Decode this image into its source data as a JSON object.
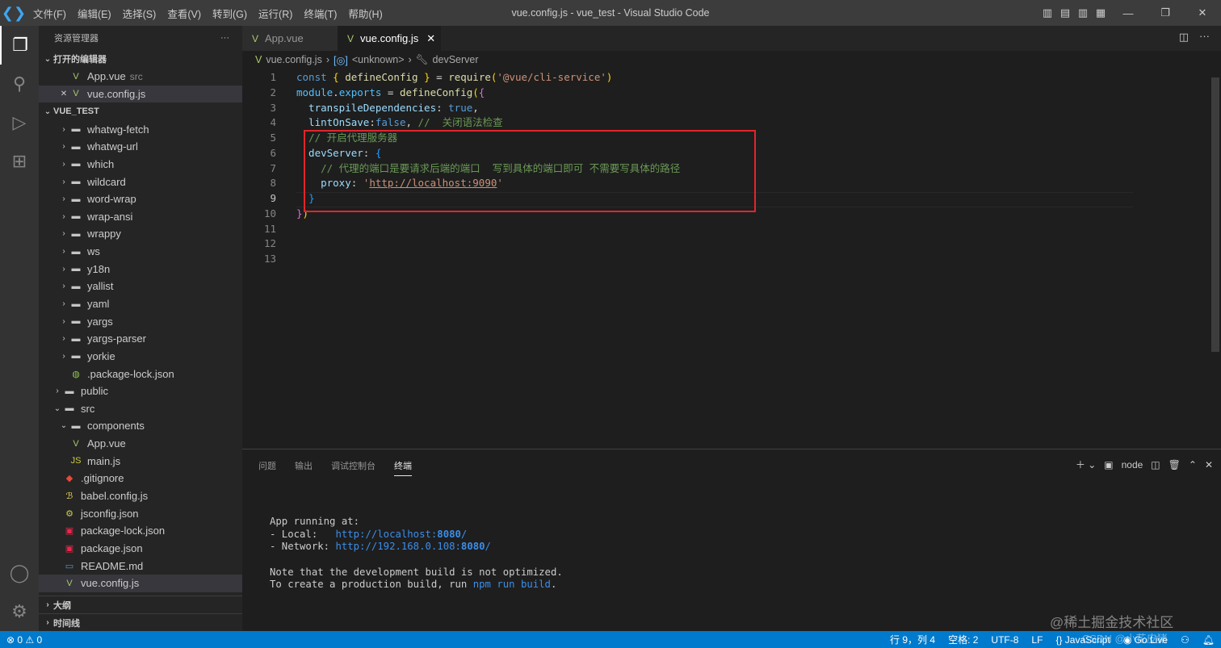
{
  "window": {
    "title": "vue.config.js - vue_test - Visual Studio Code"
  },
  "menu": [
    "文件(F)",
    "编辑(E)",
    "选择(S)",
    "查看(V)",
    "转到(G)",
    "运行(R)",
    "终端(T)",
    "帮助(H)"
  ],
  "sidebar": {
    "title": "资源管理器",
    "more": "···",
    "open_editors_header": "打开的编辑器",
    "open_editors": [
      {
        "name": "App.vue",
        "hint": "src",
        "icon": "vue-icon"
      },
      {
        "name": "vue.config.js",
        "hint": "",
        "icon": "vue-icon",
        "selected": true
      }
    ],
    "project_header": "VUE_TEST",
    "tree": [
      {
        "name": "whatwg-fetch",
        "type": "folder",
        "depth": 2
      },
      {
        "name": "whatwg-url",
        "type": "folder",
        "depth": 2
      },
      {
        "name": "which",
        "type": "folder",
        "depth": 2
      },
      {
        "name": "wildcard",
        "type": "folder",
        "depth": 2
      },
      {
        "name": "word-wrap",
        "type": "folder",
        "depth": 2
      },
      {
        "name": "wrap-ansi",
        "type": "folder",
        "depth": 2
      },
      {
        "name": "wrappy",
        "type": "folder",
        "depth": 2
      },
      {
        "name": "ws",
        "type": "folder",
        "depth": 2
      },
      {
        "name": "y18n",
        "type": "folder",
        "depth": 2
      },
      {
        "name": "yallist",
        "type": "folder",
        "depth": 2
      },
      {
        "name": "yaml",
        "type": "folder",
        "depth": 2
      },
      {
        "name": "yargs",
        "type": "folder",
        "depth": 2
      },
      {
        "name": "yargs-parser",
        "type": "folder",
        "depth": 2
      },
      {
        "name": "yorkie",
        "type": "folder",
        "depth": 2
      },
      {
        "name": ".package-lock.json",
        "type": "json",
        "depth": 2
      },
      {
        "name": "public",
        "type": "folder",
        "depth": 1
      },
      {
        "name": "src",
        "type": "folder-open",
        "depth": 1
      },
      {
        "name": "components",
        "type": "folder-open",
        "depth": 2
      },
      {
        "name": "App.vue",
        "type": "vue",
        "depth": 2
      },
      {
        "name": "main.js",
        "type": "js",
        "depth": 2
      },
      {
        "name": ".gitignore",
        "type": "git",
        "depth": 1
      },
      {
        "name": "babel.config.js",
        "type": "babel",
        "depth": 1
      },
      {
        "name": "jsconfig.json",
        "type": "jsconfig",
        "depth": 1
      },
      {
        "name": "package-lock.json",
        "type": "npm",
        "depth": 1
      },
      {
        "name": "package.json",
        "type": "npm",
        "depth": 1
      },
      {
        "name": "README.md",
        "type": "md",
        "depth": 1
      },
      {
        "name": "vue.config.js",
        "type": "vue",
        "depth": 1,
        "selected": true
      }
    ],
    "outline_header": "大纲",
    "timeline_header": "时间线"
  },
  "tabs": [
    {
      "label": "App.vue",
      "active": false
    },
    {
      "label": "vue.config.js",
      "active": true
    }
  ],
  "breadcrumb": [
    "vue.config.js",
    "<unknown>",
    "devServer"
  ],
  "code": [
    [
      [
        "const ",
        "kw"
      ],
      [
        "{ ",
        "br1"
      ],
      [
        "defineConfig ",
        "fn"
      ],
      [
        "} ",
        "br1"
      ],
      [
        "= ",
        "pl"
      ],
      [
        "require",
        "fn"
      ],
      [
        "(",
        "br1"
      ],
      [
        "'@vue/cli-service'",
        "str"
      ],
      [
        ")",
        "br1"
      ]
    ],
    [
      [
        "module",
        "var2"
      ],
      [
        ".",
        "pl"
      ],
      [
        "exports",
        "var2"
      ],
      [
        " = ",
        "pl"
      ],
      [
        "defineConfig",
        "fn"
      ],
      [
        "(",
        "br1"
      ],
      [
        "{",
        "br2"
      ]
    ],
    [
      [
        "  transpileDependencies",
        "vr"
      ],
      [
        ": ",
        "pl"
      ],
      [
        "true",
        "kw"
      ],
      [
        ",",
        "pl"
      ]
    ],
    [
      [
        "  lintOnSave",
        "vr"
      ],
      [
        ":",
        "pl"
      ],
      [
        "false",
        "kw"
      ],
      [
        ", ",
        "pl"
      ],
      [
        "//  关闭语法检查",
        "cm"
      ]
    ],
    [
      [
        "  // 开启代理服务器",
        "cm"
      ]
    ],
    [
      [
        "  devServer",
        "vr"
      ],
      [
        ": ",
        "pl"
      ],
      [
        "{",
        "br3"
      ]
    ],
    [
      [
        "    // 代理的端口是要请求后端的端口  写到具体的端口即可 不需要写具体的路径",
        "cm"
      ]
    ],
    [
      [
        "    proxy",
        "vr"
      ],
      [
        ": ",
        "pl"
      ],
      [
        "'",
        "str"
      ],
      [
        "http://localhost:9090",
        "str u"
      ],
      [
        "'",
        "str"
      ]
    ],
    [
      [
        "  ",
        "pl"
      ],
      [
        "}",
        "br3"
      ]
    ],
    [
      [
        "}",
        "br2"
      ],
      [
        ")",
        "br1"
      ]
    ],
    [],
    [],
    []
  ],
  "panel": {
    "tabs": [
      "问题",
      "输出",
      "调试控制台",
      "终端"
    ],
    "active": 3,
    "shell": "node"
  },
  "terminal": [
    [
      [
        "App running at:",
        ""
      ]
    ],
    [
      [
        "- Local:   ",
        ""
      ],
      [
        "http://localhost:",
        "cy"
      ],
      [
        "8080",
        "cyb"
      ],
      [
        "/",
        "cy"
      ]
    ],
    [
      [
        "- Network: ",
        ""
      ],
      [
        "http://192.168.0.108:",
        "cy"
      ],
      [
        "8080",
        "cyb"
      ],
      [
        "/",
        "cy"
      ]
    ],
    [],
    [
      [
        "Note that the development build is not optimized.",
        ""
      ]
    ],
    [
      [
        "To create a production build, run ",
        ""
      ],
      [
        "npm run build",
        "cy"
      ],
      [
        ".",
        ""
      ]
    ]
  ],
  "status": {
    "errors": "0",
    "warnings": "0",
    "position": "行 9，列 4",
    "spaces": "空格: 2",
    "encoding": "UTF-8",
    "eol": "LF",
    "language": "JavaScript",
    "golive": "Go Live"
  },
  "watermarks": [
    "@稀土掘金技术社区",
    "CSDN @小花皮猪"
  ],
  "colors": {
    "statusbar": "#007acc",
    "highlight_box": "#e0262b"
  }
}
